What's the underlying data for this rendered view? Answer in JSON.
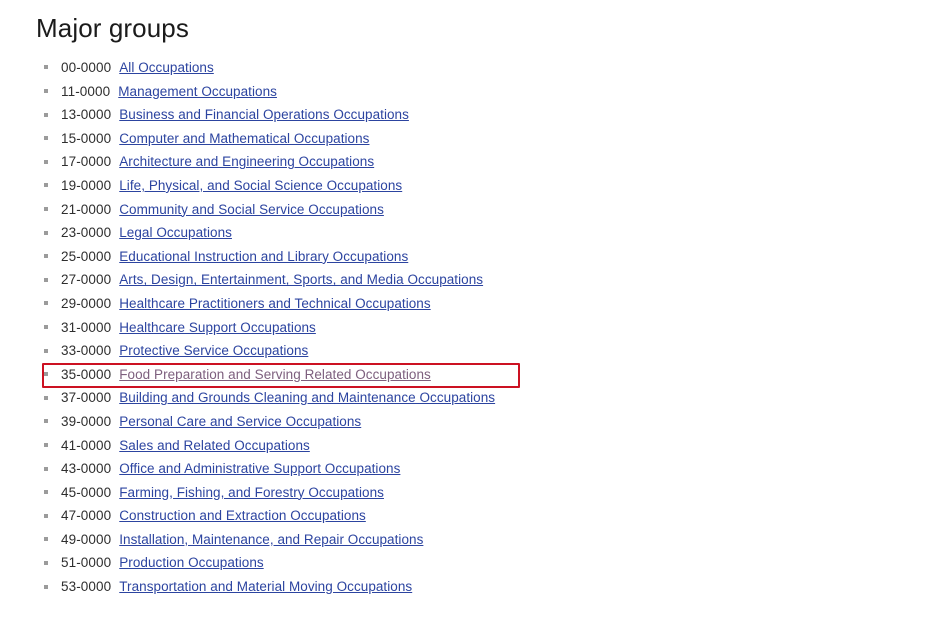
{
  "page": {
    "title": "Major groups",
    "background_color": "#ffffff",
    "link_color": "#2c44a0",
    "visited_link_color": "#7d5f7e",
    "code_color": "#2e2e2e",
    "bullet_color": "#9b9b9b"
  },
  "annotation": {
    "type": "rectangle",
    "color": "#cc1122",
    "target_index": 12,
    "target_code": "35-0000",
    "target_label": "Food Preparation and Serving Related Occupations"
  },
  "list": {
    "bullet_icon": "square-bullet-icon",
    "items": [
      {
        "code": "00-0000",
        "label": "All Occupations",
        "visited": false
      },
      {
        "code": "11-0000",
        "label": "Management Occupations",
        "visited": false
      },
      {
        "code": "13-0000",
        "label": "Business and Financial Operations Occupations",
        "visited": false
      },
      {
        "code": "15-0000",
        "label": "Computer and Mathematical Occupations",
        "visited": false
      },
      {
        "code": "17-0000",
        "label": "Architecture and Engineering Occupations",
        "visited": false
      },
      {
        "code": "19-0000",
        "label": "Life, Physical, and Social Science Occupations",
        "visited": false
      },
      {
        "code": "21-0000",
        "label": "Community and Social Service Occupations",
        "visited": false
      },
      {
        "code": "23-0000",
        "label": "Legal Occupations",
        "visited": false
      },
      {
        "code": "25-0000",
        "label": "Educational Instruction and Library Occupations",
        "visited": false
      },
      {
        "code": "27-0000",
        "label": "Arts, Design, Entertainment, Sports, and Media Occupations",
        "visited": false
      },
      {
        "code": "29-0000",
        "label": "Healthcare Practitioners and Technical Occupations",
        "visited": false
      },
      {
        "code": "31-0000",
        "label": "Healthcare Support Occupations",
        "visited": false
      },
      {
        "code": "33-0000",
        "label": "Protective Service Occupations",
        "visited": false
      },
      {
        "code": "35-0000",
        "label": "Food Preparation and Serving Related Occupations",
        "visited": true
      },
      {
        "code": "37-0000",
        "label": "Building and Grounds Cleaning and Maintenance Occupations",
        "visited": false
      },
      {
        "code": "39-0000",
        "label": "Personal Care and Service Occupations",
        "visited": false
      },
      {
        "code": "41-0000",
        "label": "Sales and Related Occupations",
        "visited": false
      },
      {
        "code": "43-0000",
        "label": "Office and Administrative Support Occupations",
        "visited": false
      },
      {
        "code": "45-0000",
        "label": "Farming, Fishing, and Forestry Occupations",
        "visited": false
      },
      {
        "code": "47-0000",
        "label": "Construction and Extraction Occupations",
        "visited": false
      },
      {
        "code": "49-0000",
        "label": "Installation, Maintenance, and Repair Occupations",
        "visited": false
      },
      {
        "code": "51-0000",
        "label": "Production Occupations",
        "visited": false
      },
      {
        "code": "53-0000",
        "label": "Transportation and Material Moving Occupations",
        "visited": false
      }
    ]
  }
}
